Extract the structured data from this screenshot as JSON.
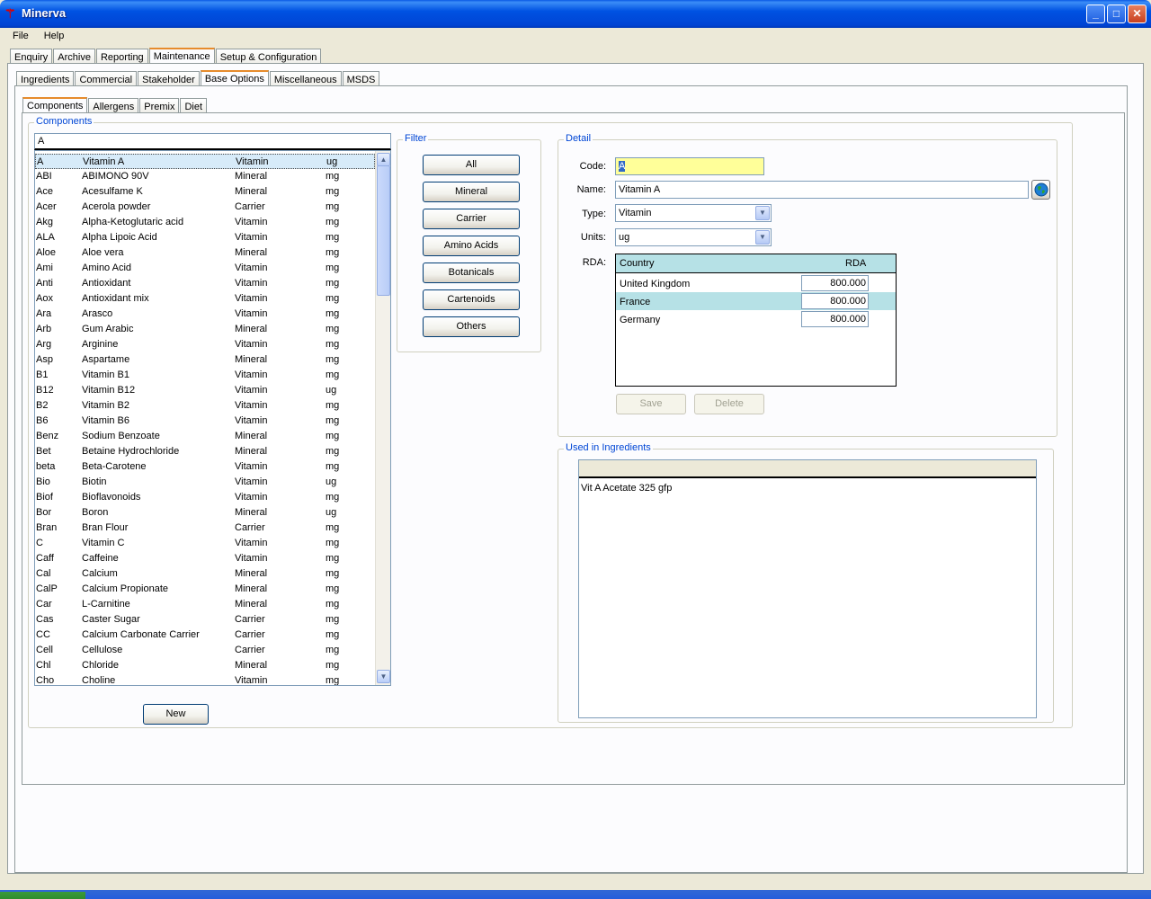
{
  "window": {
    "title": "Minerva",
    "app_icon": "minerva-logo-icon"
  },
  "menu": [
    "File",
    "Help"
  ],
  "main_tabs": [
    "Enquiry",
    "Archive",
    "Reporting",
    "Maintenance",
    "Setup & Configuration"
  ],
  "main_tab_active": "Maintenance",
  "sub_tabs": [
    "Ingredients",
    "Commercial",
    "Stakeholder",
    "Base Options",
    "Miscellaneous",
    "MSDS"
  ],
  "sub_tab_active": "Base Options",
  "inner_tabs": [
    "Components",
    "Allergens",
    "Premix",
    "Diet"
  ],
  "inner_tab_active": "Components",
  "components": {
    "group_title": "Components",
    "search_value": "A",
    "rows": [
      {
        "code": "A",
        "name": "Vitamin A",
        "type": "Vitamin",
        "unit": "ug",
        "selected": true
      },
      {
        "code": "ABI",
        "name": "ABIMONO 90V",
        "type": "Mineral",
        "unit": "mg"
      },
      {
        "code": "Ace",
        "name": "Acesulfame K",
        "type": "Mineral",
        "unit": "mg"
      },
      {
        "code": "Acer",
        "name": "Acerola powder",
        "type": "Carrier",
        "unit": "mg"
      },
      {
        "code": "Akg",
        "name": "Alpha-Ketoglutaric acid",
        "type": "Vitamin",
        "unit": "mg"
      },
      {
        "code": "ALA",
        "name": "Alpha Lipoic Acid",
        "type": "Vitamin",
        "unit": "mg"
      },
      {
        "code": "Aloe",
        "name": "Aloe vera",
        "type": "Mineral",
        "unit": "mg"
      },
      {
        "code": "Ami",
        "name": "Amino Acid",
        "type": "Vitamin",
        "unit": "mg"
      },
      {
        "code": "Anti",
        "name": "Antioxidant",
        "type": "Vitamin",
        "unit": "mg"
      },
      {
        "code": "Aox",
        "name": "Antioxidant mix",
        "type": "Vitamin",
        "unit": "mg"
      },
      {
        "code": "Ara",
        "name": "Arasco",
        "type": "Vitamin",
        "unit": "mg"
      },
      {
        "code": "Arb",
        "name": "Gum Arabic",
        "type": "Mineral",
        "unit": "mg"
      },
      {
        "code": "Arg",
        "name": "Arginine",
        "type": "Vitamin",
        "unit": "mg"
      },
      {
        "code": "Asp",
        "name": "Aspartame",
        "type": "Mineral",
        "unit": "mg"
      },
      {
        "code": "B1",
        "name": "Vitamin B1",
        "type": "Vitamin",
        "unit": "mg"
      },
      {
        "code": "B12",
        "name": "Vitamin B12",
        "type": "Vitamin",
        "unit": "ug"
      },
      {
        "code": "B2",
        "name": "Vitamin B2",
        "type": "Vitamin",
        "unit": "mg"
      },
      {
        "code": "B6",
        "name": "Vitamin B6",
        "type": "Vitamin",
        "unit": "mg"
      },
      {
        "code": "Benz",
        "name": "Sodium Benzoate",
        "type": "Mineral",
        "unit": "mg"
      },
      {
        "code": "Bet",
        "name": "Betaine Hydrochloride",
        "type": "Mineral",
        "unit": "mg"
      },
      {
        "code": "beta",
        "name": "Beta-Carotene",
        "type": "Vitamin",
        "unit": "mg"
      },
      {
        "code": "Bio",
        "name": "Biotin",
        "type": "Vitamin",
        "unit": "ug"
      },
      {
        "code": "Biof",
        "name": "Bioflavonoids",
        "type": "Vitamin",
        "unit": "mg"
      },
      {
        "code": "Bor",
        "name": "Boron",
        "type": "Mineral",
        "unit": "ug"
      },
      {
        "code": "Bran",
        "name": "Bran Flour",
        "type": "Carrier",
        "unit": "mg"
      },
      {
        "code": "C",
        "name": "Vitamin C",
        "type": "Vitamin",
        "unit": "mg"
      },
      {
        "code": "Caff",
        "name": "Caffeine",
        "type": "Vitamin",
        "unit": "mg"
      },
      {
        "code": "Cal",
        "name": "Calcium",
        "type": "Mineral",
        "unit": "mg"
      },
      {
        "code": "CalP",
        "name": "Calcium Propionate",
        "type": "Mineral",
        "unit": "mg"
      },
      {
        "code": "Car",
        "name": "L-Carnitine",
        "type": "Mineral",
        "unit": "mg"
      },
      {
        "code": "Cas",
        "name": "Caster Sugar",
        "type": "Carrier",
        "unit": "mg"
      },
      {
        "code": "CC",
        "name": "Calcium Carbonate Carrier",
        "type": "Carrier",
        "unit": "mg"
      },
      {
        "code": "Cell",
        "name": "Cellulose",
        "type": "Carrier",
        "unit": "mg"
      },
      {
        "code": "Chl",
        "name": "Chloride",
        "type": "Mineral",
        "unit": "mg"
      },
      {
        "code": "Cho",
        "name": "Choline",
        "type": "Vitamin",
        "unit": "mg"
      }
    ],
    "new_label": "New"
  },
  "filter": {
    "group_title": "Filter",
    "buttons": [
      "All",
      "Mineral",
      "Carrier",
      "Amino Acids",
      "Botanicals",
      "Cartenoids",
      "Others"
    ]
  },
  "detail": {
    "group_title": "Detail",
    "code_label": "Code:",
    "code_value": "A",
    "name_label": "Name:",
    "name_value": "Vitamin A",
    "type_label": "Type:",
    "type_value": "Vitamin",
    "units_label": "Units:",
    "units_value": "ug",
    "rda_label": "RDA:",
    "rda_headers": [
      "Country",
      "RDA"
    ],
    "rda_rows": [
      {
        "country": "United Kingdom",
        "rda": "800.000"
      },
      {
        "country": "France",
        "rda": "800.000",
        "highlighted": true
      },
      {
        "country": "Germany",
        "rda": "800.000"
      }
    ],
    "save_label": "Save",
    "delete_label": "Delete",
    "globe_icon": "globe-icon"
  },
  "used_in": {
    "group_title": "Used in Ingredients",
    "items": [
      "Vit A Acetate 325 gfp"
    ]
  },
  "colors": {
    "selection": "#d7ebf9",
    "code_highlight": "#ffff99",
    "grid_header": "#b6e1e6",
    "group_title": "#0046d5",
    "titlebar": "#0052e2"
  }
}
